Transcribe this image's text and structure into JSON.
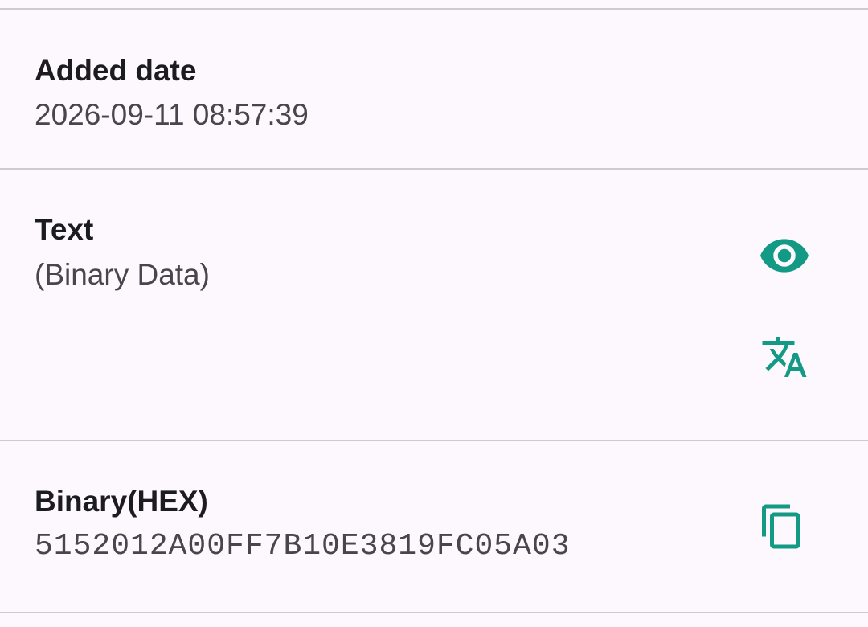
{
  "colors": {
    "background": "#fdf8fd",
    "accent": "#139a84",
    "divider": "#cfcbd0",
    "label": "#1c1b1f",
    "value": "#49454f"
  },
  "added_date": {
    "label": "Added date",
    "value": "2026-09-11 08:57:39"
  },
  "text": {
    "label": "Text",
    "value": "(Binary Data)",
    "icons": [
      "eye-icon",
      "translate-icon"
    ]
  },
  "binary_hex": {
    "label": "Binary(HEX)",
    "value": "5152012A00FF7B10E3819FC05A03",
    "icons": [
      "copy-icon"
    ]
  }
}
